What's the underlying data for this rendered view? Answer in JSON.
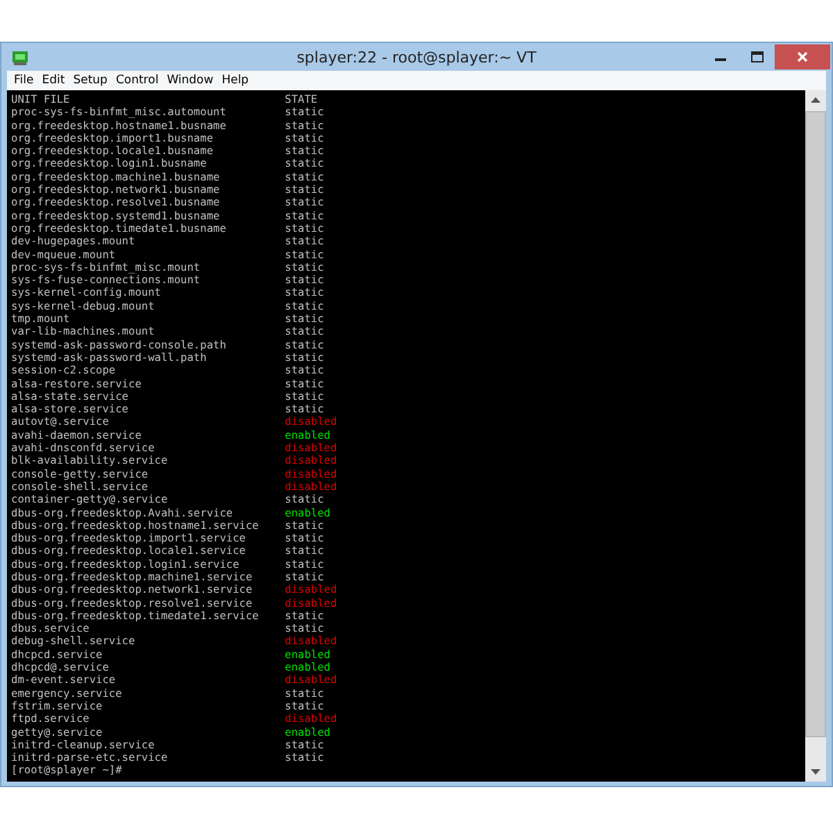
{
  "window": {
    "title": "splayer:22 - root@splayer:~ VT"
  },
  "menu": [
    {
      "label": "File"
    },
    {
      "label": "Edit"
    },
    {
      "label": "Setup"
    },
    {
      "label": "Control"
    },
    {
      "label": "Window"
    },
    {
      "label": "Help"
    }
  ],
  "terminal": {
    "header": {
      "unit": "UNIT FILE",
      "state": "STATE"
    },
    "rows": [
      {
        "unit": "proc-sys-fs-binfmt_misc.automount",
        "state": "static",
        "color": "#c0c0c0"
      },
      {
        "unit": "org.freedesktop.hostname1.busname",
        "state": "static",
        "color": "#c0c0c0"
      },
      {
        "unit": "org.freedesktop.import1.busname",
        "state": "static",
        "color": "#c0c0c0"
      },
      {
        "unit": "org.freedesktop.locale1.busname",
        "state": "static",
        "color": "#c0c0c0"
      },
      {
        "unit": "org.freedesktop.login1.busname",
        "state": "static",
        "color": "#c0c0c0"
      },
      {
        "unit": "org.freedesktop.machine1.busname",
        "state": "static",
        "color": "#c0c0c0"
      },
      {
        "unit": "org.freedesktop.network1.busname",
        "state": "static",
        "color": "#c0c0c0"
      },
      {
        "unit": "org.freedesktop.resolve1.busname",
        "state": "static",
        "color": "#c0c0c0"
      },
      {
        "unit": "org.freedesktop.systemd1.busname",
        "state": "static",
        "color": "#c0c0c0"
      },
      {
        "unit": "org.freedesktop.timedate1.busname",
        "state": "static",
        "color": "#c0c0c0"
      },
      {
        "unit": "dev-hugepages.mount",
        "state": "static",
        "color": "#c0c0c0"
      },
      {
        "unit": "dev-mqueue.mount",
        "state": "static",
        "color": "#c0c0c0"
      },
      {
        "unit": "proc-sys-fs-binfmt_misc.mount",
        "state": "static",
        "color": "#c0c0c0"
      },
      {
        "unit": "sys-fs-fuse-connections.mount",
        "state": "static",
        "color": "#c0c0c0"
      },
      {
        "unit": "sys-kernel-config.mount",
        "state": "static",
        "color": "#c0c0c0"
      },
      {
        "unit": "sys-kernel-debug.mount",
        "state": "static",
        "color": "#c0c0c0"
      },
      {
        "unit": "tmp.mount",
        "state": "static",
        "color": "#c0c0c0"
      },
      {
        "unit": "var-lib-machines.mount",
        "state": "static",
        "color": "#c0c0c0"
      },
      {
        "unit": "systemd-ask-password-console.path",
        "state": "static",
        "color": "#c0c0c0"
      },
      {
        "unit": "systemd-ask-password-wall.path",
        "state": "static",
        "color": "#c0c0c0"
      },
      {
        "unit": "session-c2.scope",
        "state": "static",
        "color": "#c0c0c0"
      },
      {
        "unit": "alsa-restore.service",
        "state": "static",
        "color": "#c0c0c0"
      },
      {
        "unit": "alsa-state.service",
        "state": "static",
        "color": "#c0c0c0"
      },
      {
        "unit": "alsa-store.service",
        "state": "static",
        "color": "#c0c0c0"
      },
      {
        "unit": "autovt@.service",
        "state": "disabled",
        "color": "#e00000"
      },
      {
        "unit": "avahi-daemon.service",
        "state": "enabled",
        "color": "#00e000"
      },
      {
        "unit": "avahi-dnsconfd.service",
        "state": "disabled",
        "color": "#e00000"
      },
      {
        "unit": "blk-availability.service",
        "state": "disabled",
        "color": "#e00000"
      },
      {
        "unit": "console-getty.service",
        "state": "disabled",
        "color": "#e00000"
      },
      {
        "unit": "console-shell.service",
        "state": "disabled",
        "color": "#e00000"
      },
      {
        "unit": "container-getty@.service",
        "state": "static",
        "color": "#c0c0c0"
      },
      {
        "unit": "dbus-org.freedesktop.Avahi.service",
        "state": "enabled",
        "color": "#00e000"
      },
      {
        "unit": "dbus-org.freedesktop.hostname1.service",
        "state": "static",
        "color": "#c0c0c0"
      },
      {
        "unit": "dbus-org.freedesktop.import1.service",
        "state": "static",
        "color": "#c0c0c0"
      },
      {
        "unit": "dbus-org.freedesktop.locale1.service",
        "state": "static",
        "color": "#c0c0c0"
      },
      {
        "unit": "dbus-org.freedesktop.login1.service",
        "state": "static",
        "color": "#c0c0c0"
      },
      {
        "unit": "dbus-org.freedesktop.machine1.service",
        "state": "static",
        "color": "#c0c0c0"
      },
      {
        "unit": "dbus-org.freedesktop.network1.service",
        "state": "disabled",
        "color": "#e00000"
      },
      {
        "unit": "dbus-org.freedesktop.resolve1.service",
        "state": "disabled",
        "color": "#e00000"
      },
      {
        "unit": "dbus-org.freedesktop.timedate1.service",
        "state": "static",
        "color": "#c0c0c0"
      },
      {
        "unit": "dbus.service",
        "state": "static",
        "color": "#c0c0c0"
      },
      {
        "unit": "debug-shell.service",
        "state": "disabled",
        "color": "#e00000"
      },
      {
        "unit": "dhcpcd.service",
        "state": "enabled",
        "color": "#00e000"
      },
      {
        "unit": "dhcpcd@.service",
        "state": "enabled",
        "color": "#00e000"
      },
      {
        "unit": "dm-event.service",
        "state": "disabled",
        "color": "#e00000"
      },
      {
        "unit": "emergency.service",
        "state": "static",
        "color": "#c0c0c0"
      },
      {
        "unit": "fstrim.service",
        "state": "static",
        "color": "#c0c0c0"
      },
      {
        "unit": "ftpd.service",
        "state": "disabled",
        "color": "#e00000"
      },
      {
        "unit": "getty@.service",
        "state": "enabled",
        "color": "#00e000"
      },
      {
        "unit": "initrd-cleanup.service",
        "state": "static",
        "color": "#c0c0c0"
      },
      {
        "unit": "initrd-parse-etc.service",
        "state": "static",
        "color": "#c0c0c0"
      }
    ],
    "prompt": "[root@splayer ~]#"
  }
}
